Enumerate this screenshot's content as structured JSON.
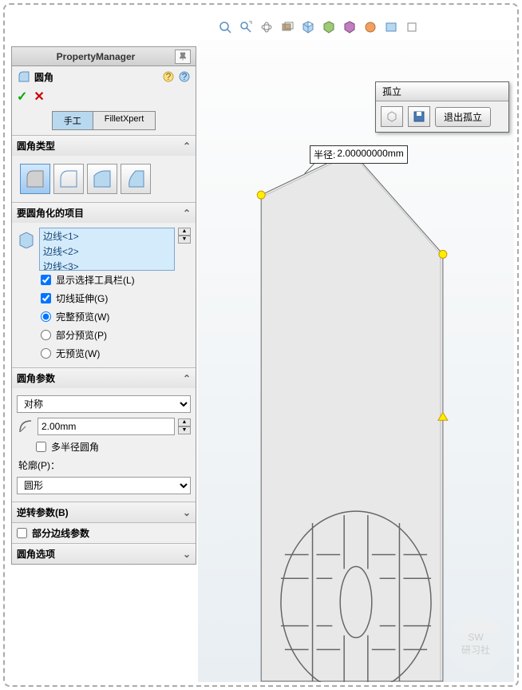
{
  "panel": {
    "title": "PropertyManager",
    "feature_name": "圆角",
    "tabs": {
      "manual": "手工",
      "expert": "FilletXpert"
    },
    "sections": {
      "type": "圆角类型",
      "items": "要圆角化的项目",
      "params": "圆角参数",
      "reverse": "逆转参数(B)",
      "partial": "部分边线参数",
      "options": "圆角选项"
    },
    "edges": [
      "边线<1>",
      "边线<2>",
      "边线<3>"
    ],
    "checkboxes": {
      "show_toolbar": "显示选择工具栏(L)",
      "tangent": "切线延伸(G)"
    },
    "radios": {
      "full_preview": "完整预览(W)",
      "partial_preview": "部分预览(P)",
      "no_preview": "无预览(W)"
    },
    "symmetry": "对称",
    "radius": "2.00mm",
    "multi_radius": "多半径圆角",
    "profile_label": "轮廓(P)：",
    "profile_value": "圆形"
  },
  "popup": {
    "title": "孤立",
    "exit": "退出孤立"
  },
  "dimension": {
    "label": "半径:",
    "value": "2.00000000mm"
  },
  "watermark": {
    "line1": "SW",
    "line2": "研习社"
  }
}
